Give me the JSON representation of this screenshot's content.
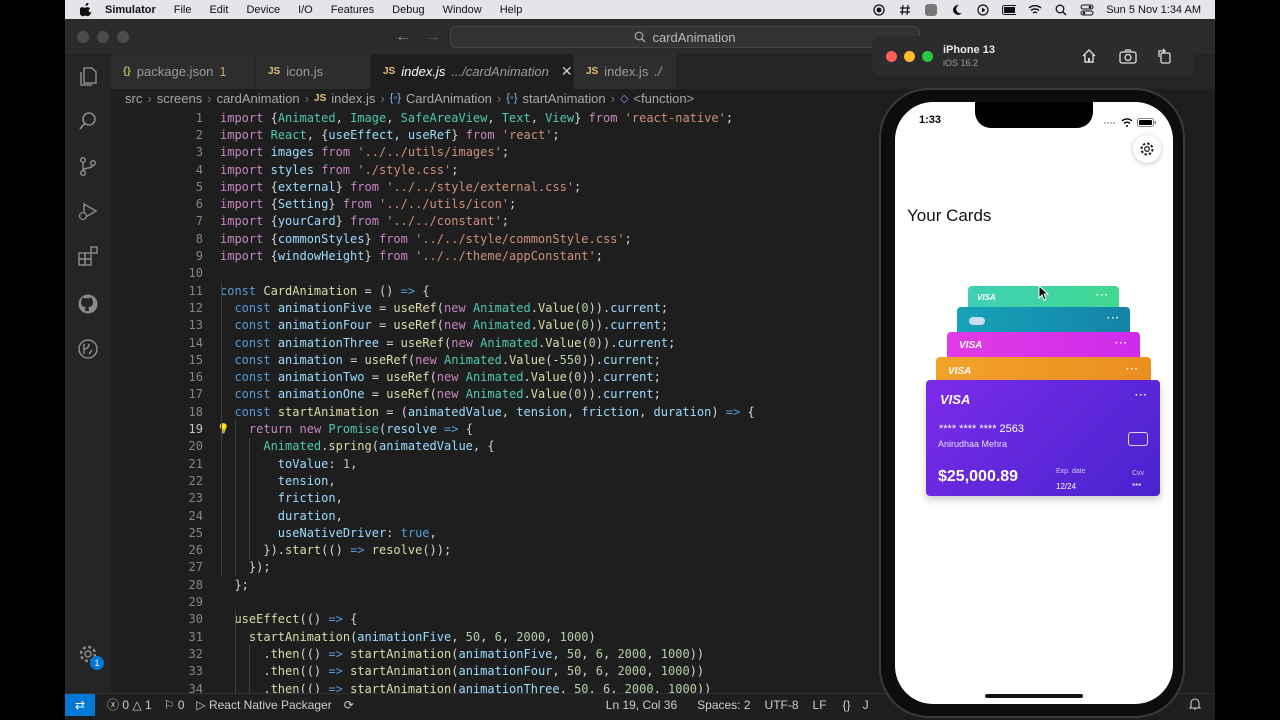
{
  "menubar": {
    "items": [
      "Simulator",
      "File",
      "Edit",
      "Device",
      "I/O",
      "Features",
      "Debug",
      "Window",
      "Help"
    ],
    "datetime": "Sun 5 Nov  1:34 AM"
  },
  "titlebar": {
    "search": "cardAnimation"
  },
  "tabs": [
    {
      "name": "package.json",
      "sub": "",
      "badge": "1",
      "type": "json"
    },
    {
      "name": "icon.js",
      "sub": "",
      "badge": "",
      "type": "js"
    },
    {
      "name": "index.js",
      "sub": ".../cardAnimation",
      "badge": "",
      "type": "js",
      "active": true
    },
    {
      "name": "index.js",
      "sub": "./",
      "badge": "",
      "type": "js"
    }
  ],
  "breadcrumb": [
    "src",
    "screens",
    "cardAnimation",
    "index.js",
    "CardAnimation",
    "startAnimation",
    "<function>"
  ],
  "code_lines": [
    "import {Animated, Image, SafeAreaView, Text, View} from 'react-native';",
    "import React, {useEffect, useRef} from 'react';",
    "import images from '../../utils/images';",
    "import styles from './style.css';",
    "import {external} from '../../style/external.css';",
    "import {Setting} from '../../utils/icon';",
    "import {yourCard} from '../../constant';",
    "import {commonStyles} from '../../style/commonStyle.css';",
    "import {windowHeight} from '../../theme/appConstant';",
    "",
    "const CardAnimation = () => {",
    "  const animationFive = useRef(new Animated.Value(0)).current;",
    "  const animationFour = useRef(new Animated.Value(0)).current;",
    "  const animationThree = useRef(new Animated.Value(0)).current;",
    "  const animation = useRef(new Animated.Value(-550)).current;",
    "  const animationTwo = useRef(new Animated.Value(0)).current;",
    "  const animationOne = useRef(new Animated.Value(0)).current;",
    "  const startAnimation = (animatedValue, tension, friction, duration) => {",
    "    return new Promise(resolve => {",
    "      Animated.spring(animatedValue, {",
    "        toValue: 1,",
    "        tension,",
    "        friction,",
    "        duration,",
    "        useNativeDriver: true,",
    "      }).start(() => resolve());",
    "    });",
    "  };",
    "",
    "  useEffect(() => {",
    "    startAnimation(animationFive, 50, 6, 2000, 1000)",
    "      .then(() => startAnimation(animationFive, 50, 6, 2000, 1000))",
    "      .then(() => startAnimation(animationFour, 50, 6, 2000, 1000))",
    "      .then(() => startAnimation(animationThree, 50, 6, 2000, 1000))"
  ],
  "current_line": 19,
  "statusbar": {
    "errors": "0",
    "warnings": "1",
    "info": "0",
    "packager": "React Native Packager",
    "position": "Ln 19, Col 36",
    "spaces": "Spaces: 2",
    "encoding": "UTF-8",
    "eol": "LF",
    "braces": "{}",
    "lang": "J"
  },
  "activity_badge": "1",
  "simulator": {
    "device": "iPhone 13",
    "os": "iOS 16.2",
    "time": "1:33",
    "heading": "Your Cards",
    "card": {
      "brand": "VISA",
      "number": "**** **** **** 2563",
      "holder": "Anirudhaa Mehra",
      "balance": "$25,000.89",
      "exp_label": "Exp. date",
      "exp": "12/24",
      "cvv_label": "Cvv",
      "cvv": "***"
    }
  },
  "colors": {
    "keyword": "#c586c0",
    "decl": "#569cd6",
    "string": "#ce9178",
    "number": "#b5cea8",
    "func": "#dcdcaa",
    "var": "#9cdcfe",
    "cls": "#4ec9b0",
    "accent": "#0078d4"
  }
}
